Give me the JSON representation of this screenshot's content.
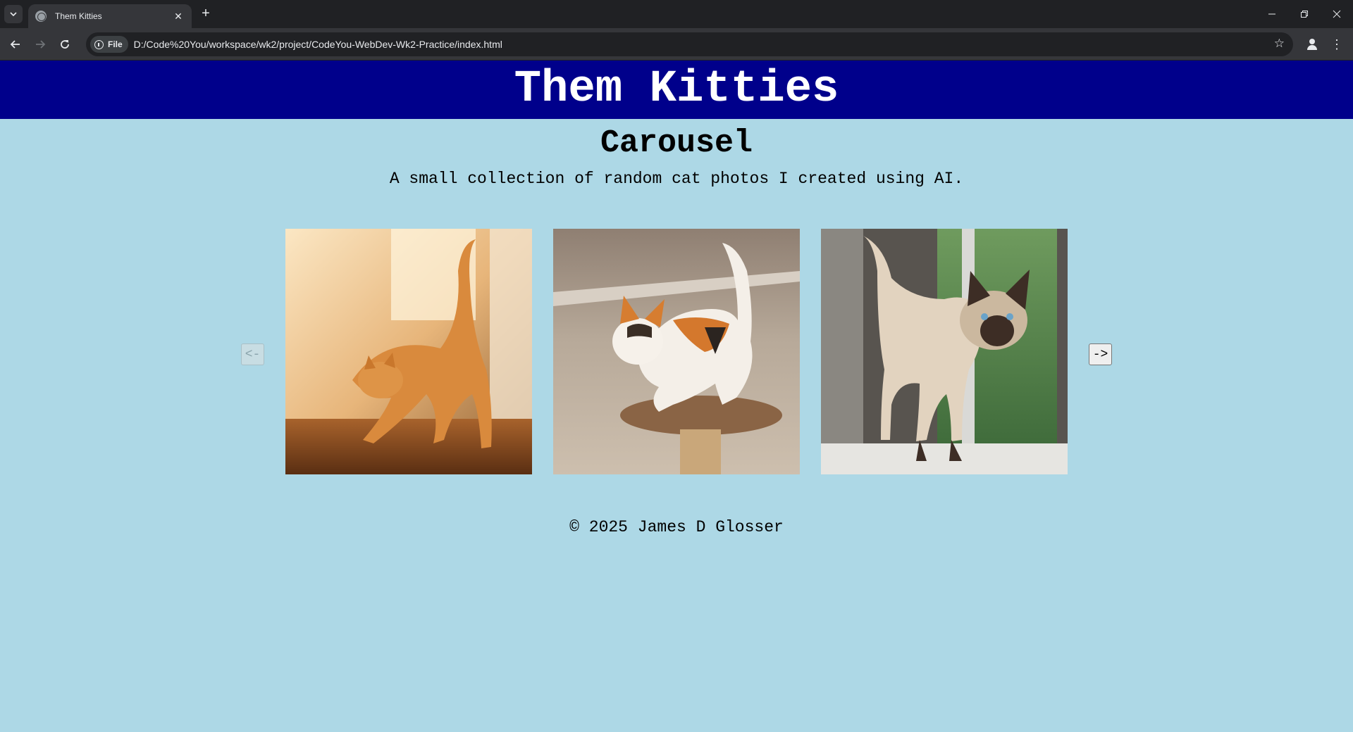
{
  "browser": {
    "tab_title": "Them Kitties",
    "tab_close": "✕",
    "new_tab": "+",
    "site_chip": "File",
    "url": "D:/Code%20You/workspace/wk2/project/CodeYou-WebDev-Wk2-Practice/index.html",
    "icons": [
      "tab-search-icon",
      "globe-icon",
      "close-icon",
      "plus-icon",
      "minimize-icon",
      "restore-icon",
      "close-window-icon",
      "back-arrow-icon",
      "forward-arrow-icon",
      "reload-icon",
      "info-icon",
      "star-icon",
      "profile-icon",
      "menu-dots-icon"
    ]
  },
  "header": {
    "title": "Them Kitties",
    "background": "#00008b"
  },
  "main": {
    "heading": "Carousel",
    "description": "A small collection of random cat photos I created using AI.",
    "prev_label": "<-",
    "next_label": "->",
    "prev_disabled": true,
    "photos": [
      {
        "subject": "orange tabby cat stretching"
      },
      {
        "subject": "calico kitten on cat tree"
      },
      {
        "subject": "siamese cat on window sill"
      }
    ]
  },
  "footer": {
    "text": "© 2025 James D Glosser"
  },
  "colors": {
    "page_background": "#add8e6",
    "header_background": "#00008b"
  }
}
